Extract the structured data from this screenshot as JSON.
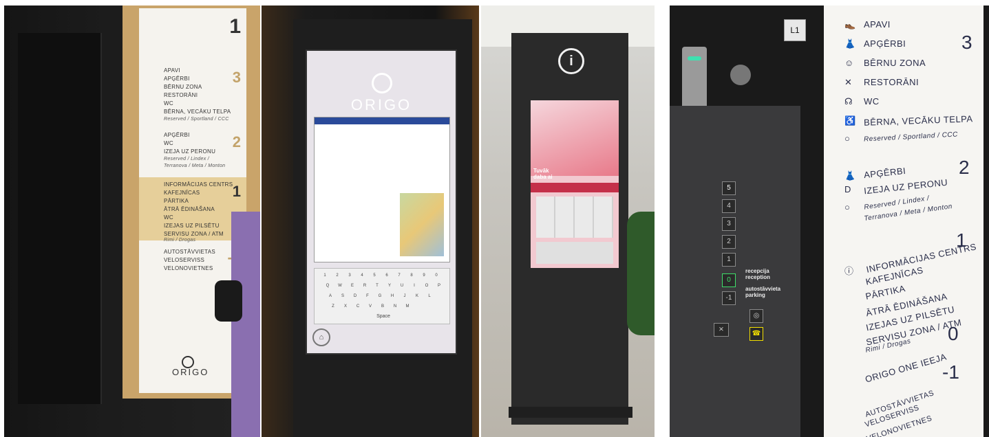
{
  "photo1": {
    "floor_top": "1",
    "floor3": "3",
    "floor2": "2",
    "floor1": "1",
    "floor_neg1": "-1",
    "items3": [
      "APAVI",
      "APĢĒRBI",
      "BĒRNU ZONA",
      "RESTORĀNI",
      "WC",
      "BĒRNA, VECĀKU TELPA"
    ],
    "note3": "Reserved / Sportland / CCC",
    "items2": [
      "APĢĒRBI",
      "WC",
      "IZEJA UZ PERONU"
    ],
    "note2a": "Reserved / Lindex /",
    "note2b": "Terranova / Meta / Monton",
    "items1": [
      "INFORMĀCIJAS CENTRS",
      "KAFEJNĪCAS",
      "PĀRTIKA",
      "ĀTRĀ ĒDINĀŠANA",
      "WC",
      "IZEJAS UZ PILSĒTU",
      "SERVISU ZONA / ATM"
    ],
    "note1": "Rimi / Drogas",
    "items_neg1": [
      "AUTOSTĀVVIETAS",
      "VELOSERVISS",
      "VELONOVIETNES"
    ],
    "logo": "ORIGO"
  },
  "photo2": {
    "brand": "ORIGO",
    "space_key": "Space",
    "keys_row1": [
      "1",
      "2",
      "3",
      "4",
      "5",
      "6",
      "7",
      "8",
      "9",
      "0"
    ],
    "keys_row2": [
      "Q",
      "W",
      "E",
      "R",
      "T",
      "Y",
      "U",
      "I",
      "O",
      "P"
    ],
    "keys_row3": [
      "A",
      "S",
      "D",
      "F",
      "G",
      "H",
      "J",
      "K",
      "L"
    ],
    "keys_row4": [
      "Z",
      "X",
      "C",
      "V",
      "B",
      "N",
      "M"
    ]
  },
  "photo3": {
    "info_symbol": "i",
    "promo_title": "Tuvāk\ndaba ai"
  },
  "photo4": {
    "car_label": "L1",
    "floor_buttons": [
      "5",
      "4",
      "3",
      "2",
      "1",
      "0",
      "-1"
    ],
    "reception_lv": "recepcija",
    "reception_en": "reception",
    "parking_lv": "autostāvvieta",
    "parking_en": "parking",
    "items3": [
      "APAVI",
      "APĢĒRBI",
      "BĒRNU ZONA",
      "RESTORĀNI",
      "WC",
      "BĒRNA, VECĀKU TELPA"
    ],
    "note3": "Reserved / Sportland / CCC",
    "floor3": "3",
    "items2": [
      "APĢĒRBI",
      "IZEJA UZ PERONU"
    ],
    "note2a": "Reserved / Lindex /",
    "note2b": "Terranova / Meta / Monton",
    "floor2": "2",
    "items1": [
      "INFORMĀCIJAS CENTRS",
      "KAFEJNĪCAS",
      "PĀRTIKA",
      "ĀTRĀ ĒDINĀŠANA",
      "IZEJAS UZ PILSĒTU",
      "SERVISU ZONA / ATM"
    ],
    "note1": "Rimi / Drogas",
    "floor1": "1",
    "item0": "ORIGO ONE IEEJA",
    "floor0": "0",
    "items_neg1": [
      "AUTOSTĀVVIETAS",
      "VELOSERVISS",
      "VELONOVIETNES"
    ],
    "floor_neg1": "-1",
    "d_label": "D"
  },
  "colors": {
    "sign_navy": "#2a2e4a",
    "gold": "#c3a36a",
    "green_led": "#3fe06a",
    "yellow_led": "#f4e000",
    "promo_red": "#c4304a"
  }
}
